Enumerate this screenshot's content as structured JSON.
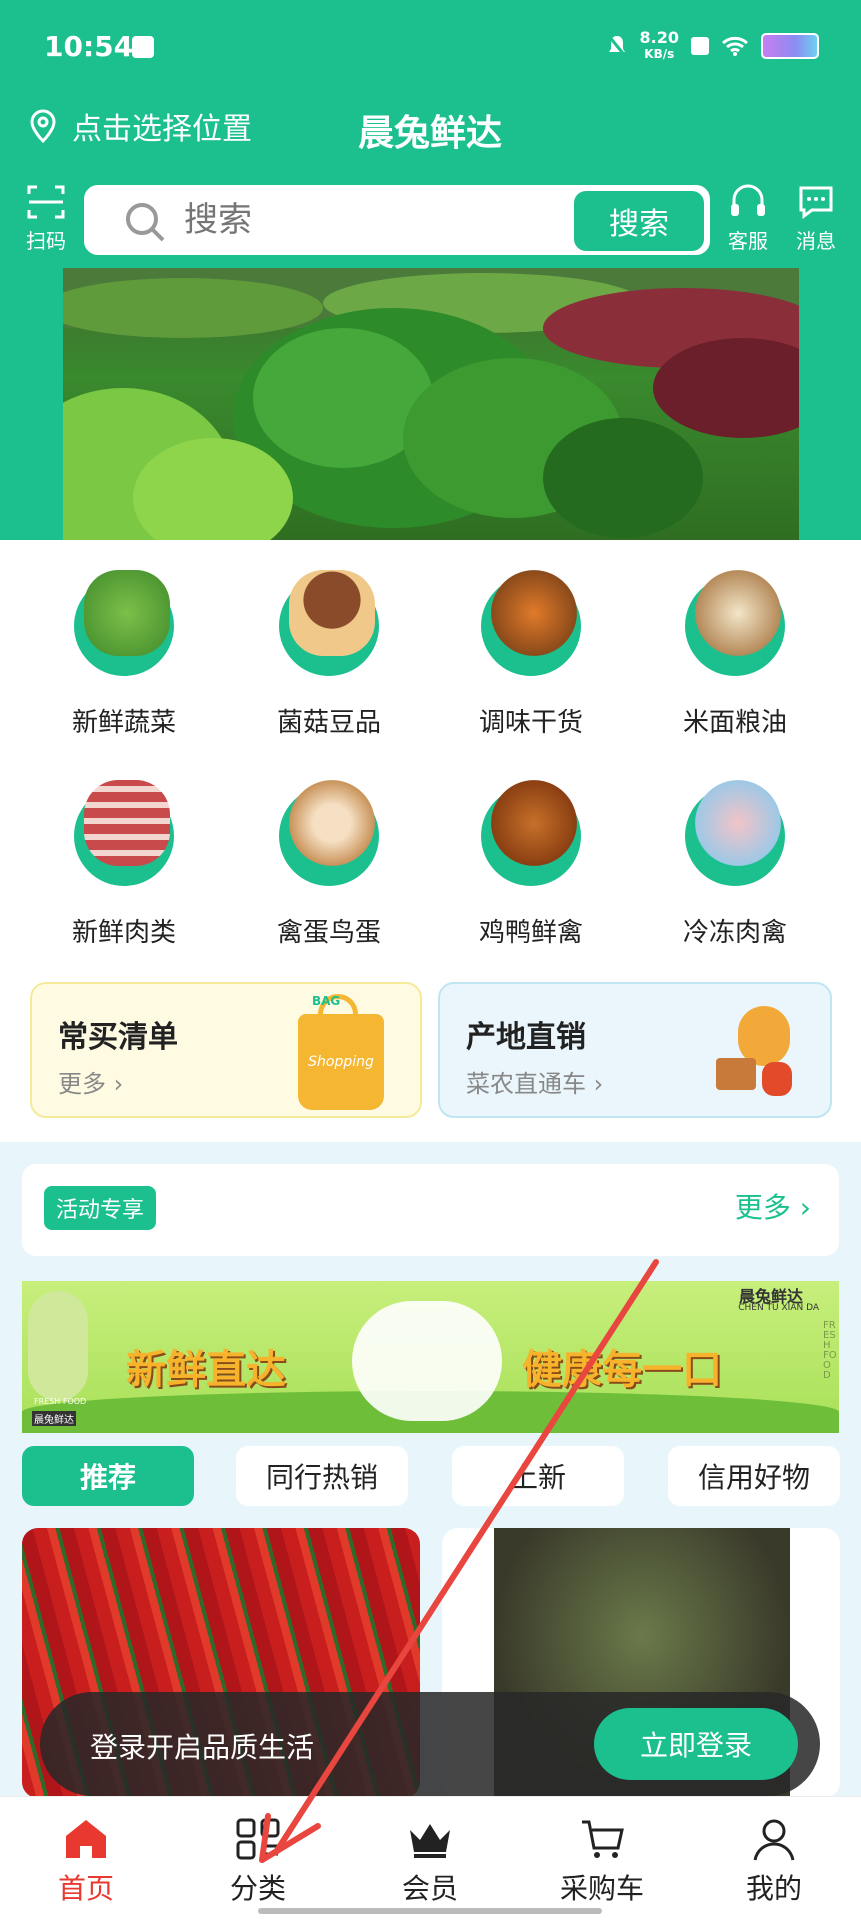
{
  "status_bar": {
    "time": "10:54",
    "speed": "8.20",
    "speed_unit": "KB/s"
  },
  "header": {
    "location_label": "点击选择位置",
    "app_title": "晨兔鲜达",
    "scan_label": "扫码",
    "service_label": "客服",
    "message_label": "消息"
  },
  "search": {
    "placeholder": "搜索",
    "button_label": "搜索"
  },
  "categories": [
    {
      "label": "新鲜蔬菜",
      "icon": "vegetable-icon"
    },
    {
      "label": "菌菇豆品",
      "icon": "mushroom-icon"
    },
    {
      "label": "调味干货",
      "icon": "spice-icon"
    },
    {
      "label": "米面粮油",
      "icon": "grain-icon"
    },
    {
      "label": "新鲜肉类",
      "icon": "meat-icon"
    },
    {
      "label": "禽蛋鸟蛋",
      "icon": "egg-icon"
    },
    {
      "label": "鸡鸭鲜禽",
      "icon": "poultry-icon"
    },
    {
      "label": "冷冻肉禽",
      "icon": "frozen-meat-icon"
    }
  ],
  "cards": {
    "frequent": {
      "title": "常买清单",
      "sub": "更多",
      "bag_label": "Shopping",
      "bag_top": "BAG"
    },
    "origin": {
      "title": "产地直销",
      "sub": "菜农直通车"
    }
  },
  "activity": {
    "tag": "活动专享",
    "more": "更多"
  },
  "promo": {
    "left_text": "新鲜直达",
    "right_text": "健康每一口",
    "brand": "晨兔鲜达",
    "brand_pinyin": "CHEN TU XIAN DA",
    "fresh_food": "FRESH FOOD",
    "badge": "晨兔鲜达"
  },
  "tabs": [
    {
      "label": "推荐",
      "active": true
    },
    {
      "label": "同行热销",
      "active": false
    },
    {
      "label": "上新",
      "active": false
    },
    {
      "label": "信用好物",
      "active": false
    }
  ],
  "login_prompt": {
    "text": "登录开启品质生活",
    "button": "立即登录"
  },
  "nav": [
    {
      "label": "首页",
      "icon": "home-icon",
      "active": true
    },
    {
      "label": "分类",
      "icon": "category-icon",
      "active": false
    },
    {
      "label": "会员",
      "icon": "crown-icon",
      "active": false
    },
    {
      "label": "采购车",
      "icon": "cart-icon",
      "active": false
    },
    {
      "label": "我的",
      "icon": "user-icon",
      "active": false
    }
  ],
  "colors": {
    "brand": "#1CC08F",
    "active_nav": "#E8382F",
    "annotation_arrow": "#E8463E"
  }
}
